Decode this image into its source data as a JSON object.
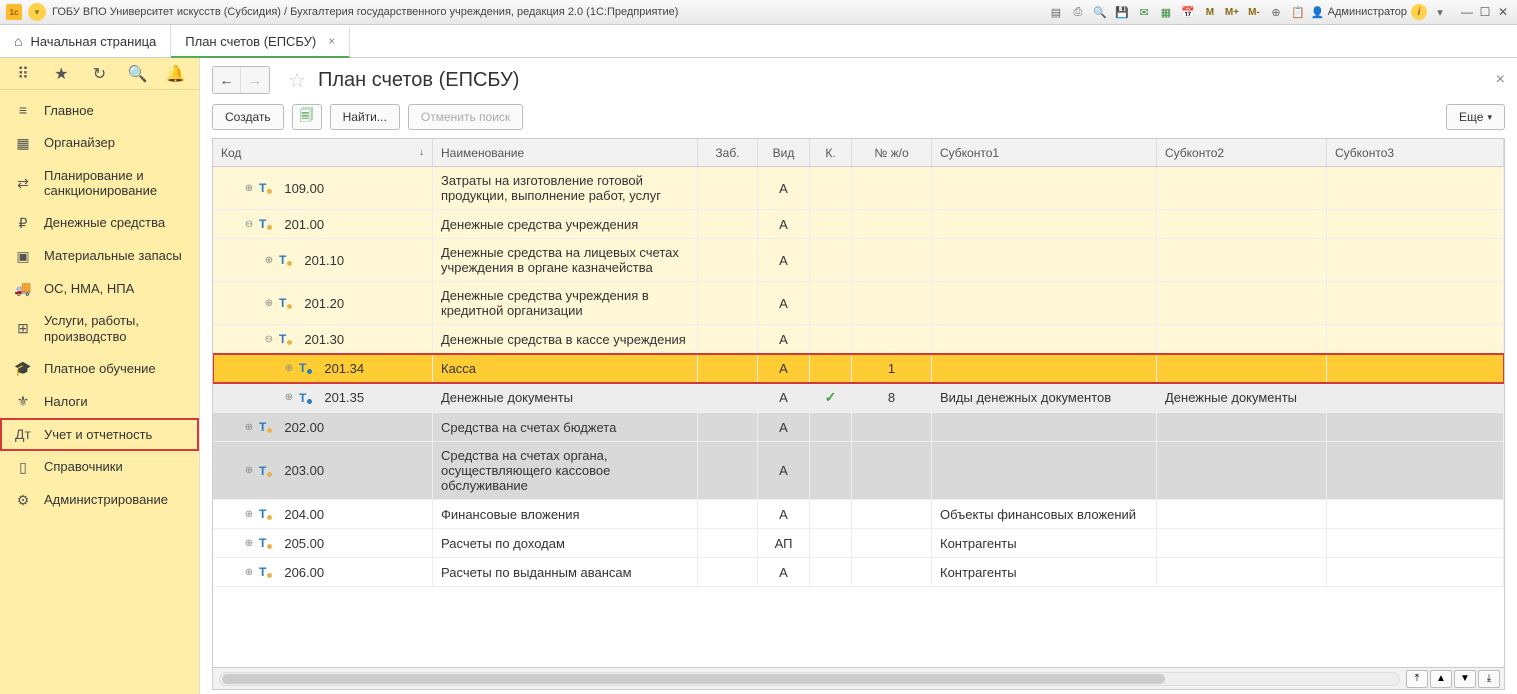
{
  "titlebar": {
    "app_logo": "1c",
    "title": "ГОБУ ВПО Университет искусств (Субсидия) / Бухгалтерия государственного учреждения, редакция 2.0  (1С:Предприятие)",
    "user": "Администратор"
  },
  "tabs": {
    "home": "Начальная страница",
    "active": "План счетов (ЕПСБУ)"
  },
  "sidebar": {
    "items": [
      {
        "icon": "≡",
        "label": "Главное"
      },
      {
        "icon": "▦",
        "label": "Органайзер"
      },
      {
        "icon": "⇄",
        "label": "Планирование и санкционирование"
      },
      {
        "icon": "₽",
        "label": "Денежные средства"
      },
      {
        "icon": "▣",
        "label": "Материальные запасы"
      },
      {
        "icon": "🚚",
        "label": "ОС, НМА, НПА"
      },
      {
        "icon": "⊞",
        "label": "Услуги, работы, производство"
      },
      {
        "icon": "🎓",
        "label": "Платное обучение"
      },
      {
        "icon": "⚜",
        "label": "Налоги"
      },
      {
        "icon": "Дт",
        "label": "Учет и отчетность"
      },
      {
        "icon": "▯",
        "label": "Справочники"
      },
      {
        "icon": "⚙",
        "label": "Администрирование"
      }
    ],
    "selected_index": 9
  },
  "page": {
    "title": "План счетов (ЕПСБУ)"
  },
  "toolbar": {
    "create": "Создать",
    "find": "Найти...",
    "cancel_search": "Отменить поиск",
    "more": "Еще"
  },
  "grid": {
    "columns": {
      "code": "Код",
      "name": "Наименование",
      "zab": "Заб.",
      "vid": "Вид",
      "k": "К.",
      "njo": "№ ж/о",
      "sub1": "Субконто1",
      "sub2": "Субконто2",
      "sub3": "Субконто3"
    },
    "rows": [
      {
        "indent": 0,
        "toggle": "⊕",
        "dot": "yellow",
        "code": "109.00",
        "name": "Затраты на изготовление готовой продукции, выполнение работ, услуг",
        "vid": "А",
        "rowstyle": "yellow"
      },
      {
        "indent": 0,
        "toggle": "⊖",
        "dot": "yellow",
        "code": "201.00",
        "name": "Денежные средства учреждения",
        "vid": "А",
        "rowstyle": "yellow"
      },
      {
        "indent": 1,
        "toggle": "⊕",
        "dot": "yellow",
        "code": "201.10",
        "name": "Денежные средства на лицевых счетах учреждения в органе казначейства",
        "vid": "А",
        "rowstyle": "yellow"
      },
      {
        "indent": 1,
        "toggle": "⊕",
        "dot": "yellow",
        "code": "201.20",
        "name": "Денежные средства учреждения в кредитной организации",
        "vid": "А",
        "rowstyle": "yellow"
      },
      {
        "indent": 1,
        "toggle": "⊖",
        "dot": "yellow",
        "code": "201.30",
        "name": "Денежные средства  в кассе учреждения",
        "vid": "А",
        "rowstyle": "yellow"
      },
      {
        "indent": 2,
        "toggle": "⊕",
        "dot": "blue",
        "code": "201.34",
        "name": "Касса",
        "vid": "А",
        "njo": "1",
        "rowstyle": "selected"
      },
      {
        "indent": 2,
        "toggle": "⊕",
        "dot": "blue",
        "code": "201.35",
        "name": "Денежные документы",
        "vid": "А",
        "k": "✓",
        "njo": "8",
        "sub1": "Виды денежных документов",
        "sub2": "Денежные документы",
        "rowstyle": "hover"
      },
      {
        "indent": 0,
        "toggle": "⊕",
        "dot": "yellow",
        "code": "202.00",
        "name": "Средства на счетах бюджета",
        "vid": "А",
        "rowstyle": "grey"
      },
      {
        "indent": 0,
        "toggle": "⊕",
        "dot": "yellow",
        "code": "203.00",
        "name": "Средства на счетах органа, осуществляющего кассовое обслуживание",
        "vid": "А",
        "rowstyle": "grey"
      },
      {
        "indent": 0,
        "toggle": "⊕",
        "dot": "yellow",
        "code": "204.00",
        "name": "Финансовые вложения",
        "vid": "А",
        "sub1": "Объекты финансовых вложений",
        "rowstyle": "white"
      },
      {
        "indent": 0,
        "toggle": "⊕",
        "dot": "yellow",
        "code": "205.00",
        "name": "Расчеты по доходам",
        "vid": "АП",
        "sub1": "Контрагенты",
        "rowstyle": "white"
      },
      {
        "indent": 0,
        "toggle": "⊕",
        "dot": "yellow",
        "code": "206.00",
        "name": "Расчеты по выданным авансам",
        "vid": "А",
        "sub1": "Контрагенты",
        "rowstyle": "white"
      }
    ]
  }
}
